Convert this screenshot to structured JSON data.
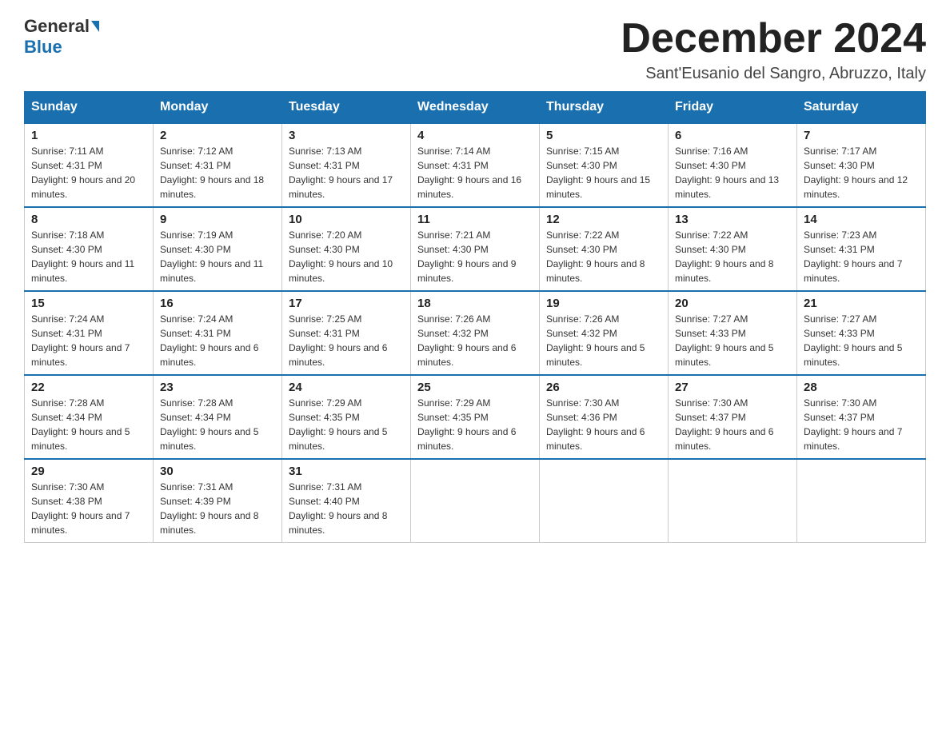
{
  "header": {
    "logo_general": "General",
    "logo_blue": "Blue",
    "month_title": "December 2024",
    "location": "Sant'Eusanio del Sangro, Abruzzo, Italy"
  },
  "days_of_week": [
    "Sunday",
    "Monday",
    "Tuesday",
    "Wednesday",
    "Thursday",
    "Friday",
    "Saturday"
  ],
  "weeks": [
    [
      {
        "day": "1",
        "sunrise": "7:11 AM",
        "sunset": "4:31 PM",
        "daylight": "9 hours and 20 minutes."
      },
      {
        "day": "2",
        "sunrise": "7:12 AM",
        "sunset": "4:31 PM",
        "daylight": "9 hours and 18 minutes."
      },
      {
        "day": "3",
        "sunrise": "7:13 AM",
        "sunset": "4:31 PM",
        "daylight": "9 hours and 17 minutes."
      },
      {
        "day": "4",
        "sunrise": "7:14 AM",
        "sunset": "4:31 PM",
        "daylight": "9 hours and 16 minutes."
      },
      {
        "day": "5",
        "sunrise": "7:15 AM",
        "sunset": "4:30 PM",
        "daylight": "9 hours and 15 minutes."
      },
      {
        "day": "6",
        "sunrise": "7:16 AM",
        "sunset": "4:30 PM",
        "daylight": "9 hours and 13 minutes."
      },
      {
        "day": "7",
        "sunrise": "7:17 AM",
        "sunset": "4:30 PM",
        "daylight": "9 hours and 12 minutes."
      }
    ],
    [
      {
        "day": "8",
        "sunrise": "7:18 AM",
        "sunset": "4:30 PM",
        "daylight": "9 hours and 11 minutes."
      },
      {
        "day": "9",
        "sunrise": "7:19 AM",
        "sunset": "4:30 PM",
        "daylight": "9 hours and 11 minutes."
      },
      {
        "day": "10",
        "sunrise": "7:20 AM",
        "sunset": "4:30 PM",
        "daylight": "9 hours and 10 minutes."
      },
      {
        "day": "11",
        "sunrise": "7:21 AM",
        "sunset": "4:30 PM",
        "daylight": "9 hours and 9 minutes."
      },
      {
        "day": "12",
        "sunrise": "7:22 AM",
        "sunset": "4:30 PM",
        "daylight": "9 hours and 8 minutes."
      },
      {
        "day": "13",
        "sunrise": "7:22 AM",
        "sunset": "4:30 PM",
        "daylight": "9 hours and 8 minutes."
      },
      {
        "day": "14",
        "sunrise": "7:23 AM",
        "sunset": "4:31 PM",
        "daylight": "9 hours and 7 minutes."
      }
    ],
    [
      {
        "day": "15",
        "sunrise": "7:24 AM",
        "sunset": "4:31 PM",
        "daylight": "9 hours and 7 minutes."
      },
      {
        "day": "16",
        "sunrise": "7:24 AM",
        "sunset": "4:31 PM",
        "daylight": "9 hours and 6 minutes."
      },
      {
        "day": "17",
        "sunrise": "7:25 AM",
        "sunset": "4:31 PM",
        "daylight": "9 hours and 6 minutes."
      },
      {
        "day": "18",
        "sunrise": "7:26 AM",
        "sunset": "4:32 PM",
        "daylight": "9 hours and 6 minutes."
      },
      {
        "day": "19",
        "sunrise": "7:26 AM",
        "sunset": "4:32 PM",
        "daylight": "9 hours and 5 minutes."
      },
      {
        "day": "20",
        "sunrise": "7:27 AM",
        "sunset": "4:33 PM",
        "daylight": "9 hours and 5 minutes."
      },
      {
        "day": "21",
        "sunrise": "7:27 AM",
        "sunset": "4:33 PM",
        "daylight": "9 hours and 5 minutes."
      }
    ],
    [
      {
        "day": "22",
        "sunrise": "7:28 AM",
        "sunset": "4:34 PM",
        "daylight": "9 hours and 5 minutes."
      },
      {
        "day": "23",
        "sunrise": "7:28 AM",
        "sunset": "4:34 PM",
        "daylight": "9 hours and 5 minutes."
      },
      {
        "day": "24",
        "sunrise": "7:29 AM",
        "sunset": "4:35 PM",
        "daylight": "9 hours and 5 minutes."
      },
      {
        "day": "25",
        "sunrise": "7:29 AM",
        "sunset": "4:35 PM",
        "daylight": "9 hours and 6 minutes."
      },
      {
        "day": "26",
        "sunrise": "7:30 AM",
        "sunset": "4:36 PM",
        "daylight": "9 hours and 6 minutes."
      },
      {
        "day": "27",
        "sunrise": "7:30 AM",
        "sunset": "4:37 PM",
        "daylight": "9 hours and 6 minutes."
      },
      {
        "day": "28",
        "sunrise": "7:30 AM",
        "sunset": "4:37 PM",
        "daylight": "9 hours and 7 minutes."
      }
    ],
    [
      {
        "day": "29",
        "sunrise": "7:30 AM",
        "sunset": "4:38 PM",
        "daylight": "9 hours and 7 minutes."
      },
      {
        "day": "30",
        "sunrise": "7:31 AM",
        "sunset": "4:39 PM",
        "daylight": "9 hours and 8 minutes."
      },
      {
        "day": "31",
        "sunrise": "7:31 AM",
        "sunset": "4:40 PM",
        "daylight": "9 hours and 8 minutes."
      },
      null,
      null,
      null,
      null
    ]
  ]
}
